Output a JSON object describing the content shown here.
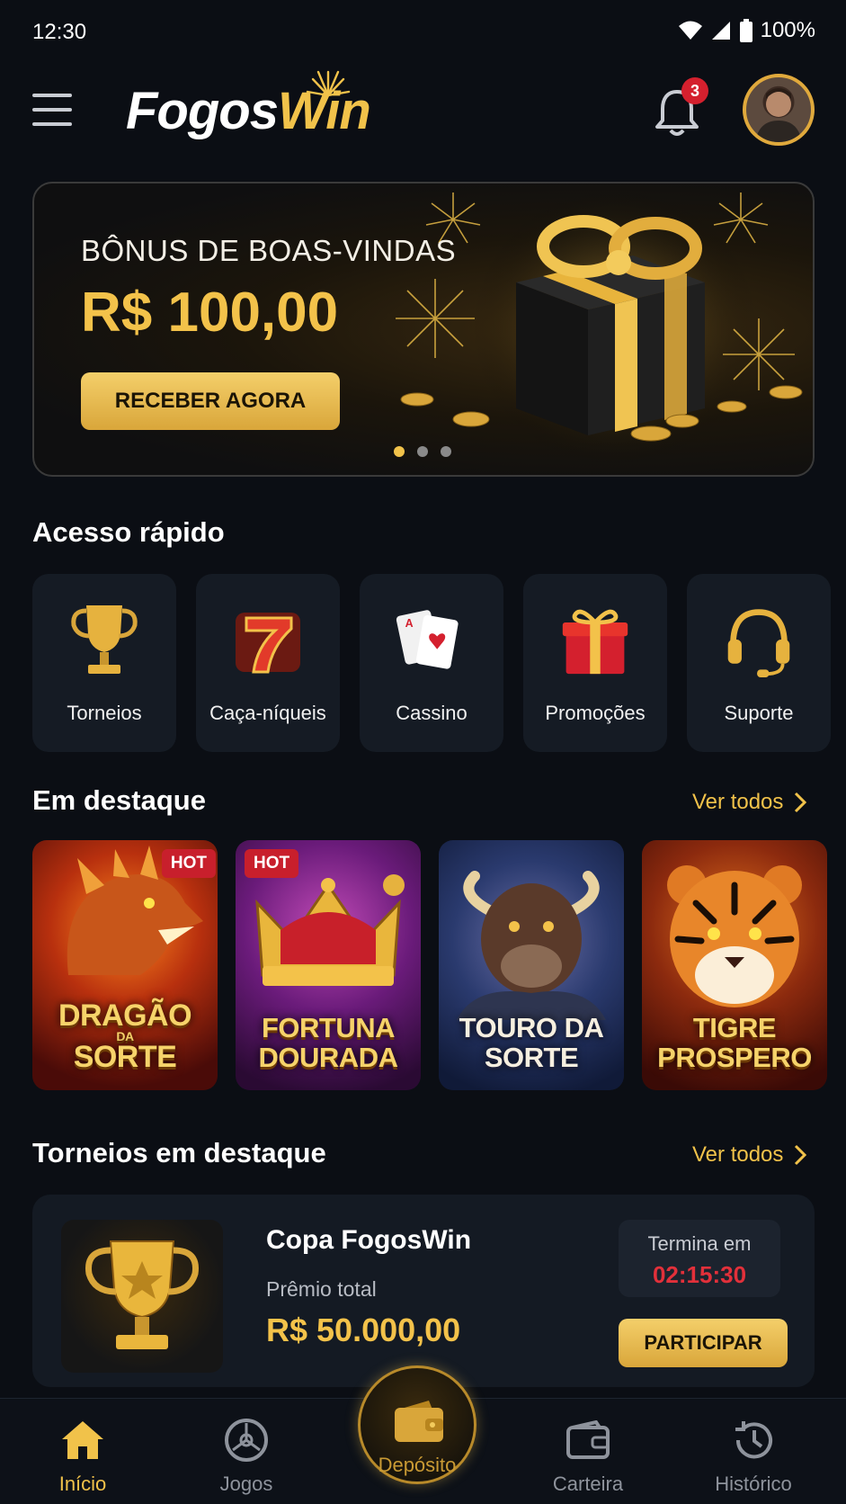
{
  "status_bar": {
    "time": "12:30",
    "battery": "100%"
  },
  "header": {
    "logo_part1": "Fogos",
    "logo_part2": "Win",
    "notification_count": "3"
  },
  "banner": {
    "eyebrow": "BÔNUS DE BOAS-VINDAS",
    "amount": "R$ 100,00",
    "cta_label": "RECEBER AGORA",
    "slides": 3,
    "active_slide": 1
  },
  "quick_access": {
    "title": "Acesso rápido",
    "items": [
      {
        "label": "Torneios",
        "icon": "trophy-icon"
      },
      {
        "label": "Caça-níqueis",
        "icon": "slot-seven-icon"
      },
      {
        "label": "Cassino",
        "icon": "playing-cards-icon"
      },
      {
        "label": "Promoções",
        "icon": "gift-icon"
      },
      {
        "label": "Suporte",
        "icon": "headset-icon"
      }
    ]
  },
  "featured": {
    "title": "Em destaque",
    "see_all": "Ver todos",
    "games": [
      {
        "title_line1": "DRAGÃO",
        "title_small": "DA",
        "title_line2": "SORTE",
        "badge": "HOT"
      },
      {
        "title_line1": "FORTUNA",
        "title_line2": "DOURADA",
        "badge": "HOT"
      },
      {
        "title_line1": "TOURO DA",
        "title_line2": "SORTE"
      },
      {
        "title_line1": "TIGRE",
        "title_line2": "PROSPERO"
      }
    ]
  },
  "tournaments": {
    "title": "Torneios em destaque",
    "see_all": "Ver todos",
    "card": {
      "name": "Copa FogosWin",
      "prize_label": "Prêmio total",
      "prize": "R$ 50.000,00",
      "ends_label": "Termina em",
      "countdown": "02:15:30",
      "join_label": "PARTICIPAR"
    }
  },
  "bottom_nav": {
    "items": [
      {
        "label": "Início",
        "icon": "home-icon",
        "active": true
      },
      {
        "label": "Jogos",
        "icon": "games-icon"
      },
      {
        "label": "Depósito",
        "icon": "wallet-icon"
      },
      {
        "label": "Carteira",
        "icon": "wallet-outline-icon"
      },
      {
        "label": "Histórico",
        "icon": "history-icon"
      }
    ]
  },
  "colors": {
    "accent_gold": "#f1c24a",
    "badge_red": "#d4202e",
    "background": "#0b0e14"
  }
}
